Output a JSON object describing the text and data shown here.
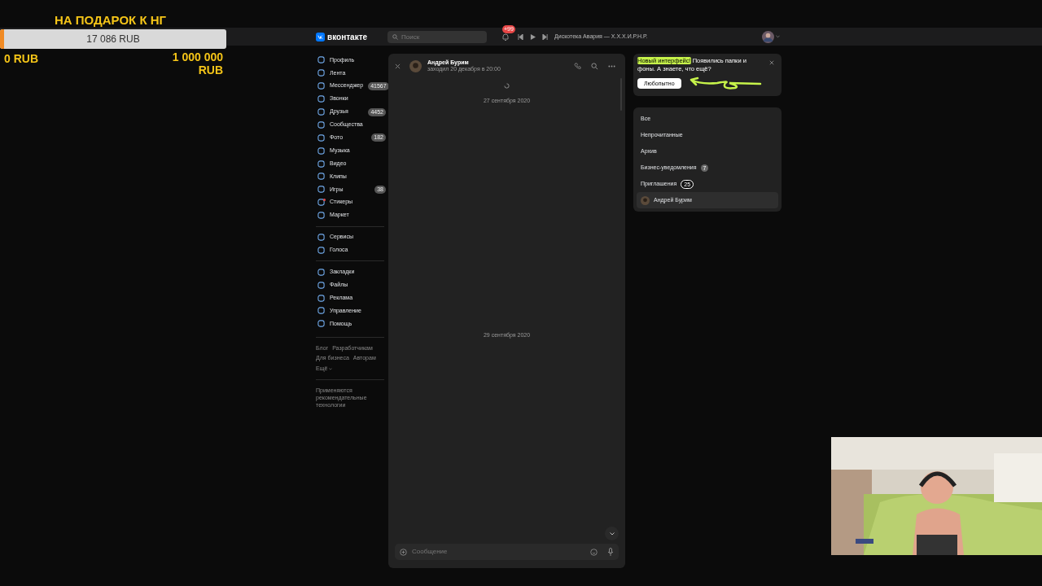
{
  "stream_overlay": {
    "goal_title": "НА ПОДАРОК К НГ",
    "goal_amount": "17 086 RUB",
    "level": 0.017,
    "goal_min": "0 RUB",
    "goal_max": "1 000 000 RUB"
  },
  "header": {
    "logo_text": "вконтакте",
    "search": {
      "placeholder": "Поиск"
    },
    "notifications_badge": "+99",
    "now_playing": "Дискотека Авария — Х.Х.Х.И.Р.Н.Р."
  },
  "sidebar": {
    "groups": [
      [
        {
          "label": "Профиль"
        },
        {
          "label": "Лента"
        },
        {
          "label": "Мессенджер",
          "badge": "41567"
        },
        {
          "label": "Звонки"
        },
        {
          "label": "Друзья",
          "badge": "4452"
        },
        {
          "label": "Сообщества"
        },
        {
          "label": "Фото",
          "badge": "182"
        },
        {
          "label": "Музыка"
        },
        {
          "label": "Видео"
        },
        {
          "label": "Клипы"
        },
        {
          "label": "Игры",
          "badge": "38"
        },
        {
          "label": "Стикеры",
          "dot": true
        },
        {
          "label": "Маркет"
        }
      ],
      [
        {
          "label": "Сервисы"
        },
        {
          "label": "Голоса"
        }
      ],
      [
        {
          "label": "Закладки"
        },
        {
          "label": "Файлы"
        },
        {
          "label": "Реклама"
        },
        {
          "label": "Управление"
        },
        {
          "label": "Помощь"
        }
      ]
    ],
    "footer_links": [
      "Блог",
      "Разработчикам",
      "Для бизнеса",
      "Авторам",
      "Ещё"
    ],
    "note": "Применяются рекомендательные технологии"
  },
  "chat": {
    "name": "Андрей Бурим",
    "status": "заходил 20 декабря в 20:00",
    "dates": [
      "27 сентября 2020",
      "29 сентября 2020"
    ],
    "message_field": {
      "placeholder": "Сообщение"
    }
  },
  "promo": {
    "highlight": "Новый интерфейс!",
    "text": "Появились папки и фоны. А знаете, что ещё?",
    "button": "Любопытно"
  },
  "folders": [
    {
      "label": "Все",
      "selected": false
    },
    {
      "label": "Непрочитанные",
      "selected": false
    },
    {
      "label": "Архив",
      "selected": false
    },
    {
      "label": "Бизнес-уведомления",
      "selected": false,
      "badge": {
        "text": "7",
        "kind": "filled"
      }
    },
    {
      "label": "Приглашения",
      "selected": false,
      "badge": {
        "text": "25",
        "kind": "outline"
      }
    },
    {
      "label": "Андрей Бурим",
      "selected": true,
      "kind": "chat"
    }
  ]
}
